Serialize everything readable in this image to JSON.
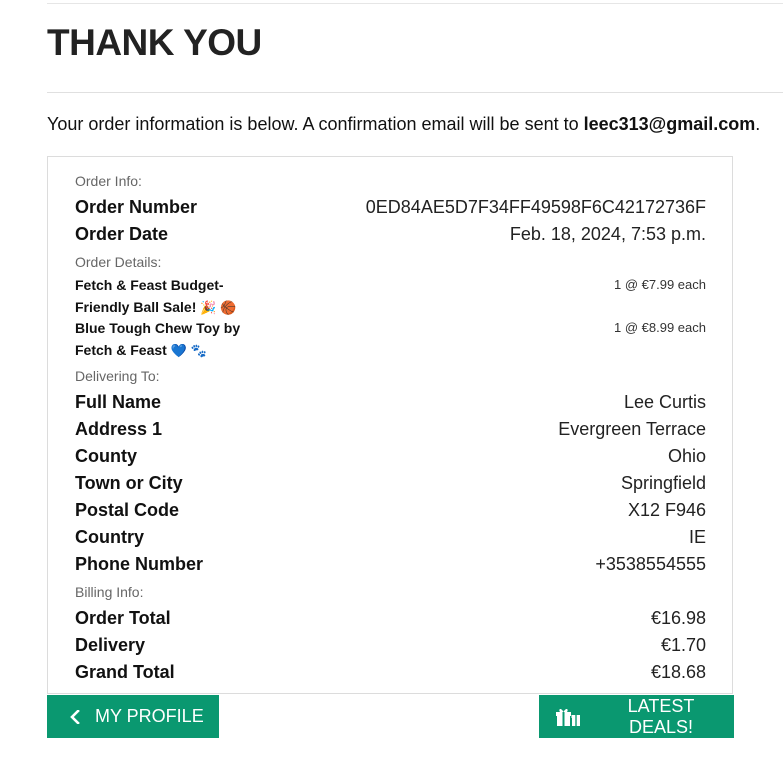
{
  "header": {
    "title": "THANK YOU"
  },
  "intro": {
    "text": "Your order information is below. A confirmation email will be sent to ",
    "email": "leec313@gmail.com",
    "suffix": "."
  },
  "order_info": {
    "label": "Order Info:",
    "rows": [
      {
        "key": "Order Number",
        "value": "0ED84AE5D7F34FF49598F6C42172736F"
      },
      {
        "key": "Order Date",
        "value": "Feb. 18, 2024, 7:53 p.m."
      }
    ]
  },
  "order_details": {
    "label": "Order Details:",
    "items": [
      {
        "name": "Fetch & Feast Budget-Friendly Ball Sale!",
        "emoji": "🎉 🏀",
        "qty": "1 @ €7.99 each"
      },
      {
        "name": "Blue Tough Chew Toy by Fetch & Feast",
        "emoji": "💙 🐾",
        "qty": "1 @ €8.99 each"
      }
    ]
  },
  "delivering_to": {
    "label": "Delivering To:",
    "rows": [
      {
        "key": "Full Name",
        "value": "Lee Curtis"
      },
      {
        "key": "Address 1",
        "value": "Evergreen Terrace"
      },
      {
        "key": "County",
        "value": "Ohio"
      },
      {
        "key": "Town or City",
        "value": "Springfield"
      },
      {
        "key": "Postal Code",
        "value": "X12 F946"
      },
      {
        "key": "Country",
        "value": "IE"
      },
      {
        "key": "Phone Number",
        "value": "+3538554555"
      }
    ]
  },
  "billing_info": {
    "label": "Billing Info:",
    "rows": [
      {
        "key": "Order Total",
        "value": "€16.98"
      },
      {
        "key": "Delivery",
        "value": "€1.70"
      },
      {
        "key": "Grand Total",
        "value": "€18.68"
      }
    ]
  },
  "buttons": {
    "profile_label": "MY PROFILE",
    "profile_icon": "chevron-left-icon",
    "deals_label": "LATEST DEALS!",
    "deals_icon": "gifts-icon"
  },
  "colors": {
    "button_bg": "#0a9870",
    "button_text": "#ffffff"
  }
}
